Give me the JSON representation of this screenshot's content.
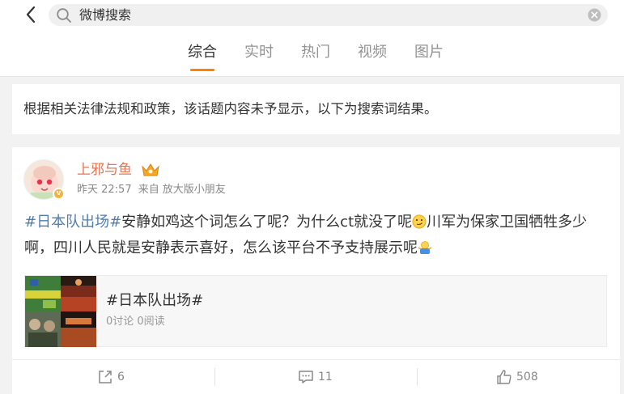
{
  "search": {
    "query": "微博搜索"
  },
  "tabs": [
    {
      "label": "综合",
      "active": true
    },
    {
      "label": "实时",
      "active": false
    },
    {
      "label": "热门",
      "active": false
    },
    {
      "label": "视频",
      "active": false
    },
    {
      "label": "图片",
      "active": false
    }
  ],
  "notice": {
    "text": "根据相关法律法规和政策，该话题内容未予显示，以下为搜索词结果。"
  },
  "post": {
    "username": "上邪与鱼",
    "time": "昨天 22:57",
    "source_prefix": "来自",
    "source": "放大版小朋友",
    "hashtag": "#日本队出场#",
    "text_part1": "安静如鸡这个词怎么了呢？为什么ct就没了呢",
    "text_part2": "川军为保家卫国牺牲多少啊，四川人民就是安静表示喜好，怎么该平台不予支持展示呢",
    "topic": {
      "title": "#日本队出场#",
      "stats": "0讨论 0阅读"
    },
    "actions": {
      "repost": "6",
      "comment": "11",
      "like": "508"
    }
  },
  "colors": {
    "accent": "#ff8200",
    "username": "#eb7350",
    "hashtag": "#507daf"
  }
}
